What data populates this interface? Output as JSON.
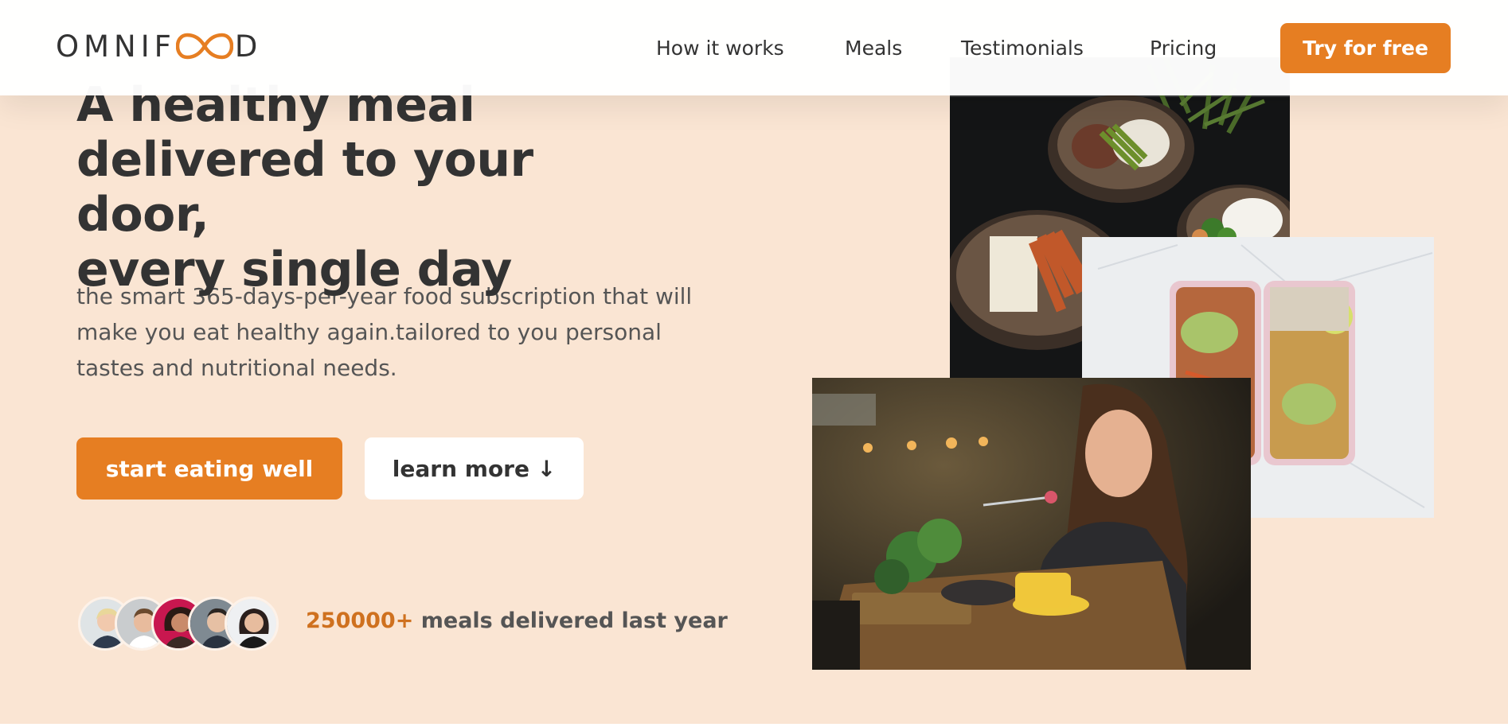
{
  "brand": {
    "name_left": "OMNIF",
    "name_right": "D",
    "accent_color": "#e67e22",
    "logo_icon": "infinity-icon"
  },
  "nav": {
    "items": [
      {
        "label": "How it works"
      },
      {
        "label": "Meals"
      },
      {
        "label": "Testimonials"
      },
      {
        "label": "Pricing"
      }
    ],
    "cta_label": "Try for free"
  },
  "hero": {
    "title_line1": "A healthy meal",
    "title_line2": "delivered to your door,",
    "title_line3": "every single day",
    "description": "the smart 365-days-per-year food subscription that will make you eat healthy again.tailored to you personal tastes and nutritional needs.",
    "primary_button": "start eating well",
    "secondary_button": "learn more ↓",
    "delivered_count": "250000+",
    "delivered_text": " meals delivered last year"
  },
  "images": {
    "top": "food-bowls-photo",
    "right": "meal-prep-boxes-photo",
    "bottom": "woman-eating-photo"
  }
}
